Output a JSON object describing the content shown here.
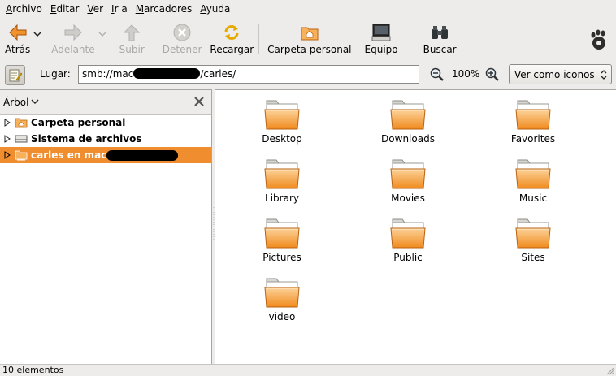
{
  "menu": [
    {
      "label": "Archivo",
      "mnemonic": "A",
      "rest": "rchivo"
    },
    {
      "label": "Editar",
      "mnemonic": "E",
      "rest": "ditar"
    },
    {
      "label": "Ver",
      "mnemonic": "V",
      "rest": "er"
    },
    {
      "label": "Ir a",
      "mnemonic": "I",
      "rest": "r a"
    },
    {
      "label": "Marcadores",
      "mnemonic": "M",
      "rest": "arcadores"
    },
    {
      "label": "Ayuda",
      "mnemonic": "A",
      "rest": "yuda"
    }
  ],
  "toolbar": {
    "back": "Atrás",
    "forward": "Adelante",
    "up": "Subir",
    "stop": "Detener",
    "reload": "Recargar",
    "home": "Carpeta personal",
    "computer": "Equipo",
    "search": "Buscar"
  },
  "location": {
    "label": "Lugar:",
    "prefix": "smb://mac",
    "suffix": "/carles/",
    "zoom": "100%",
    "view_mode": "Ver como iconos"
  },
  "sidebar": {
    "title": "Árbol",
    "items": [
      {
        "label": "Carpeta personal"
      },
      {
        "label": "Sistema de archivos"
      },
      {
        "label": "carles en mac"
      }
    ]
  },
  "folders": [
    "Desktop",
    "Downloads",
    "Favorites",
    "Library",
    "Movies",
    "Music",
    "Pictures",
    "Public",
    "Sites",
    "video"
  ],
  "status": "10 elementos",
  "colors": {
    "selection": "#f08d2f",
    "folder": "#f5a53a"
  }
}
